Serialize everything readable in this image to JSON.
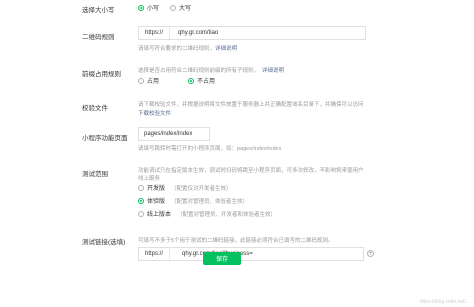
{
  "case": {
    "label": "选择大小写",
    "options": [
      {
        "label": "小写",
        "selected": true
      },
      {
        "label": "大写",
        "selected": false
      }
    ]
  },
  "qr_rule": {
    "label": "二维码规则",
    "prefix": "https://",
    "value": "qhy.gr.com/tiao",
    "hint": "请填写符合要求的二维码规则，",
    "hint_link": "详细说明"
  },
  "prefix_occupy": {
    "label": "前缀占用规则",
    "hint": "选择是否占用符合二维码规则前缀的所有子规则。",
    "hint_link": "详细说明",
    "options": [
      {
        "label": "占用",
        "selected": false
      },
      {
        "label": "不占用",
        "selected": true
      }
    ]
  },
  "verify_file": {
    "label": "校验文件",
    "hint": "请下载校验文件，并根据说明将文件放置于服务器上并正确配置域名目录下，并确保可以访问",
    "link": "下载校验文件"
  },
  "mini_page": {
    "label": "小程序功能页面",
    "value": "pages/index/index",
    "hint": "请填写跳转时需打开的小程序页面，如：pages/index/index"
  },
  "test_scope": {
    "label": "测试范围",
    "hint_line1": "功能调试只在指定版本生效，调试时扫码将跳至小程序页面，可多次修改，不影响将来使用户",
    "hint_line2": "线上服务",
    "options": [
      {
        "label": "开发版",
        "note": "（配置仅对开发者生效）",
        "selected": false
      },
      {
        "label": "体验版",
        "note": "（配置对管理员、体验者生效）",
        "selected": true
      },
      {
        "label": "线上版本",
        "note": "（配置对管理员、开发者和体验者生效）",
        "selected": false
      }
    ]
  },
  "test_link": {
    "label": "测试链接(选填)",
    "hint": "可填写不多于5个用于测试的二维码链接，此链接必须符合已填写的二维码规则。",
    "prefix": "https://",
    "value": "qhy.gr.com/tiao?business=",
    "add_icon": "plus-circle-icon"
  },
  "save_label": "保存",
  "watermark": "https://blog.csdn.net/..."
}
